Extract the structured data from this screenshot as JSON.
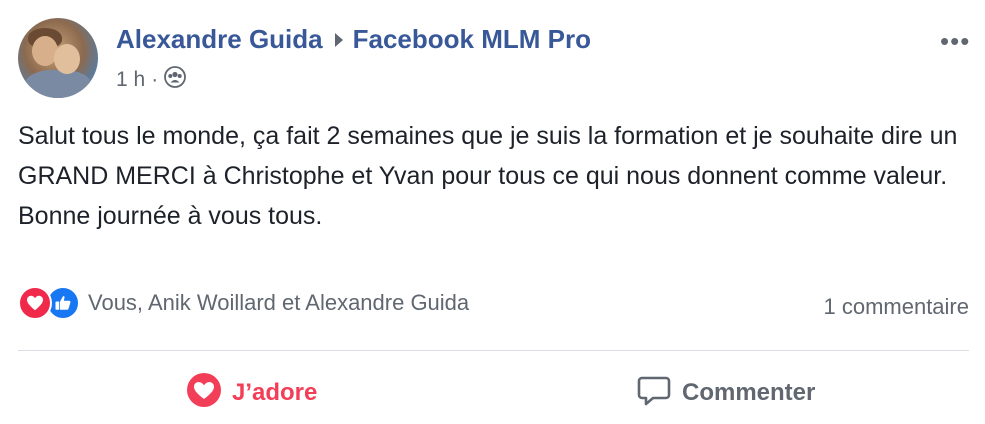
{
  "post": {
    "author": "Alexandre Guida",
    "group": "Facebook MLM Pro",
    "time": "1 h",
    "separator": "·",
    "text_lines": [
      "Salut tous le monde, ça fait 2 semaines que je suis la formation et je souhaite dire un GRAND MERCI à Christophe et Yvan pour tous ce qui nous donnent comme valeur.",
      "Bonne journée à vous tous."
    ],
    "more_label": "•••"
  },
  "reactions": {
    "reactors": "Vous, Anik Woillard et Alexandre Guida",
    "comments": "1 commentaire",
    "icons": [
      "love-icon",
      "like-icon"
    ]
  },
  "actions": {
    "love_label": "J’adore",
    "comment_label": "Commenter"
  },
  "colors": {
    "link_blue": "#385898",
    "love_red": "#f33e58",
    "like_blue": "#1877f2",
    "secondary_text": "#606770"
  }
}
